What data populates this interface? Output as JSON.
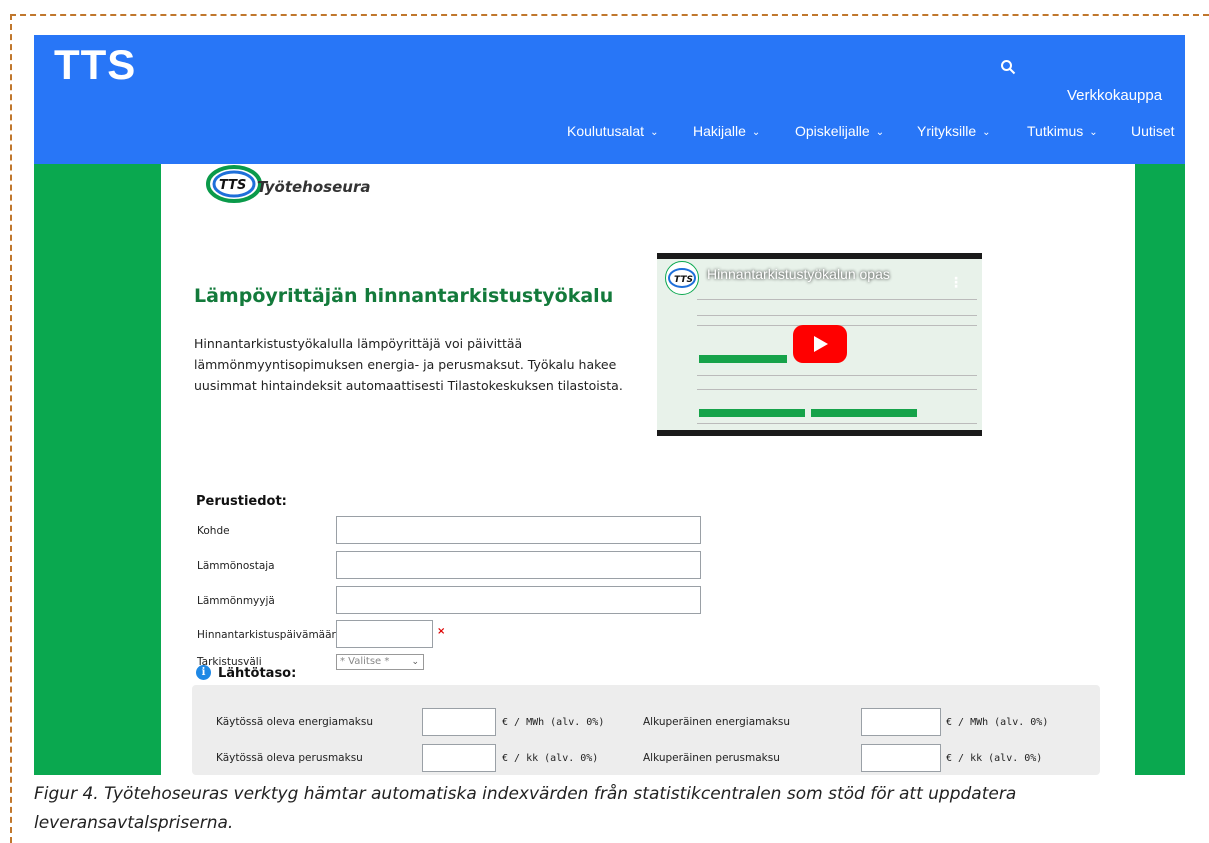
{
  "header": {
    "logo": "TTS",
    "shop_link": "Verkkokauppa",
    "search_icon": "search-icon",
    "nav": [
      {
        "label": "Koulutusalat"
      },
      {
        "label": "Hakijalle"
      },
      {
        "label": "Opiskelijalle"
      },
      {
        "label": "Yrityksille"
      },
      {
        "label": "Tutkimus"
      },
      {
        "label": "Uutiset"
      }
    ]
  },
  "brand": {
    "name": "Työtehoseura",
    "logo_text": "TTS"
  },
  "main": {
    "title": "Lämpöyrittäjän hinnantarkistustyökalu",
    "intro": "Hinnantarkistustyökalulla lämpöyrittäjä voi päivittää lämmönmyyntisopimuksen energia- ja perusmaksut. Työkalu hakee uusimmat hintaindeksit automaattisesti Tilastokeskuksen tilastoista."
  },
  "video": {
    "title": "Hinnantarkistustyökalun opas",
    "channel_logo": "TTS",
    "play_icon": "youtube-play-icon",
    "menu_icon": "more-vert-icon"
  },
  "basic_info": {
    "heading": "Perustiedot:",
    "fields": [
      {
        "label": "Kohde",
        "value": ""
      },
      {
        "label": "Lämmönostaja",
        "value": ""
      },
      {
        "label": "Lämmönmyyjä",
        "value": ""
      },
      {
        "label": "Hinnantarkistuspäivämäärä",
        "value": "",
        "required_mark": "×"
      },
      {
        "label": "Tarkistusväli",
        "selected": "* Valitse *"
      }
    ]
  },
  "baseline": {
    "heading": "Lähtötaso:",
    "info_icon": "info-icon",
    "rows": [
      {
        "left_label": "Käytössä oleva energiamaksu",
        "left_unit": "€ / MWh (alv. 0%)",
        "right_label": "Alkuperäinen energiamaksu",
        "right_unit": "€ / MWh (alv. 0%)"
      },
      {
        "left_label": "Käytössä oleva perusmaksu",
        "left_unit": "€ / kk (alv. 0%)",
        "right_label": "Alkuperäinen perusmaksu",
        "right_unit": "€ / kk (alv. 0%)"
      }
    ]
  },
  "caption": "Figur 4. Työtehoseuras verktyg hämtar automatiska indexvärden från statistikcentralen som stöd för att uppdatera leveransavtalspriserna.",
  "colors": {
    "header_blue": "#2876f7",
    "brand_green": "#0aa84f",
    "title_green": "#137a3b",
    "frame_dashed": "#c0772d"
  }
}
